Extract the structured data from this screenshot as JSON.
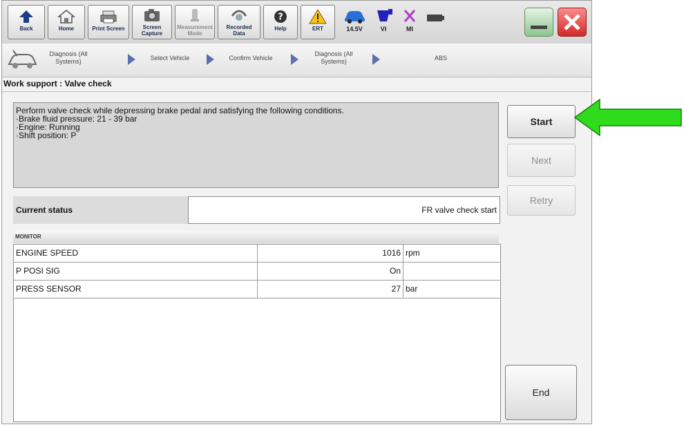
{
  "toolbar": {
    "back": "Back",
    "home": "Home",
    "print_screen": "Print Screen",
    "screen_capture_1": "Screen",
    "screen_capture_2": "Capture",
    "measurement_1": "Measurement",
    "measurement_2": "Mode",
    "recorded_1": "Recorded",
    "recorded_2": "Data",
    "help": "Help",
    "ert": "ERT",
    "battery_voltage": "14.5V",
    "vi": "VI",
    "mi": "MI"
  },
  "breadcrumb": {
    "step1_line1": "Diagnosis (All",
    "step1_line2": "Systems)",
    "step2": "Select Vehicle",
    "step3": "Confirm Vehicle",
    "step4_line1": "Diagnosis (All",
    "step4_line2": "Systems)",
    "step5": "ABS"
  },
  "page_title": "Work support : Valve check",
  "instructions": [
    "Perform valve check while depressing brake pedal and satisfying the following conditions.",
    "·Brake fluid pressure: 21 - 39 bar",
    "·Engine: Running",
    "·Shift position: P"
  ],
  "buttons": {
    "start": "Start",
    "next": "Next",
    "retry": "Retry",
    "end": "End"
  },
  "current_status": {
    "label": "Current status",
    "value": "FR valve check start"
  },
  "monitor": {
    "header": "MONITOR",
    "rows": [
      {
        "name": "ENGINE SPEED",
        "value": "1016",
        "unit": "rpm"
      },
      {
        "name": "P POSI SIG",
        "value": "On",
        "unit": ""
      },
      {
        "name": "PRESS SENSOR",
        "value": "27",
        "unit": "bar"
      }
    ]
  },
  "colors": {
    "callout_arrow": "#2edc1c",
    "close_button": "#e03a3a",
    "minimize_button": "#7fc080"
  }
}
